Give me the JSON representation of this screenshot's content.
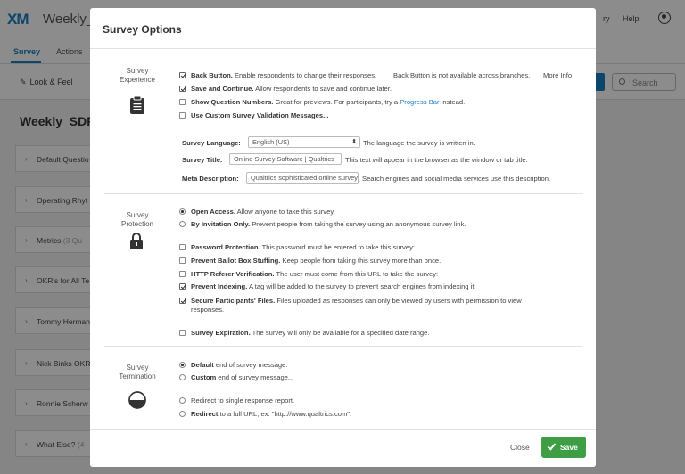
{
  "app": {
    "logo": "XM",
    "title": "Weekly_S",
    "nav_right": [
      "ry",
      "Help"
    ],
    "tabs": [
      "Survey",
      "Actions"
    ],
    "toolbar": {
      "look_feel": "Look & Feel",
      "search_placeholder": "Search"
    },
    "survey_heading": "Weekly_SDR",
    "blocks": [
      {
        "label": "Default Questio",
        "sub": ""
      },
      {
        "label": "Operating Rhyt",
        "sub": ""
      },
      {
        "label": "Metrics",
        "sub": "(3 Qu"
      },
      {
        "label": "OKR's for All Te",
        "sub": ""
      },
      {
        "label": "Tommy Herman",
        "sub": ""
      },
      {
        "label": "Nick Binks OKR",
        "sub": ""
      },
      {
        "label": "Ronnie Scherw",
        "sub": ""
      },
      {
        "label": "What Else?",
        "sub": "(4"
      }
    ]
  },
  "modal": {
    "title": "Survey Options",
    "sections": {
      "experience": {
        "label": [
          "Survey",
          "Experience"
        ],
        "options": [
          {
            "bold": "Back Button.",
            "text": " Enable respondents to change their responses."
          },
          {
            "bold": "Save and Continue.",
            "text": " Allow respondents to save and continue later."
          },
          {
            "bold": "Show Question Numbers.",
            "text": " Great for previews. For participants, try a ",
            "link": "Progress Bar",
            "after": " instead."
          },
          {
            "bold": "Use Custom Survey Validation Messages...",
            "text": ""
          }
        ],
        "back_button_note": "Back Button is not available across branches.",
        "more_info": "More Info",
        "language": {
          "label": "Survey Language:",
          "value": "English (US)",
          "help": "The language the survey is written in."
        },
        "survey_title": {
          "label": "Survey Title:",
          "value": "Online Survey Software | Qualtrics",
          "help": "This text will appear in the browser as the window or tab title."
        },
        "meta": {
          "label": "Meta Description:",
          "value": "Qualtrics sophisticated online survey",
          "help": "Search engines and social media services use this description."
        }
      },
      "protection": {
        "label": [
          "Survey",
          "Protection"
        ],
        "radios": [
          {
            "bold": "Open Access.",
            "text": " Allow anyone to take this survey."
          },
          {
            "bold": "By Invitation Only.",
            "text": " Prevent people from taking the survey using an anonymous survey link."
          }
        ],
        "checks": [
          {
            "bold": "Password Protection.",
            "text": " This password must be entered to take this survey:"
          },
          {
            "bold": "Prevent Ballot Box Stuffing.",
            "text": " Keep people from taking this survey more than once."
          },
          {
            "bold": "HTTP Referer Verification.",
            "text": " The user must come from this URL to take the survey:"
          },
          {
            "bold": "Prevent Indexing.",
            "text": " A tag will be added to the survey to prevent search engines from indexing it."
          },
          {
            "bold": "Secure Participants' Files.",
            "text": " Files uploaded as responses can only be viewed by users with permission to view responses."
          },
          {
            "bold": "Survey Expiration.",
            "text": " The survey will only be available for a specified date range."
          }
        ]
      },
      "termination": {
        "label": [
          "Survey",
          "Termination"
        ],
        "radios": [
          {
            "bold": "Default",
            "text": " end of survey message."
          },
          {
            "bold": "Custom",
            "text": " end of survey message..."
          },
          {
            "bold": "",
            "text": "Redirect to single response report."
          },
          {
            "bold": "Redirect",
            "text": " to a full URL, ex. \"http://www.qualtrics.com\":"
          }
        ]
      }
    },
    "footer": {
      "close": "Close",
      "save": "Save"
    }
  },
  "colors": {
    "accent": "#1a7fc2",
    "save_green": "#3e9e43",
    "overlay": "rgba(0,0,0,0.45)"
  }
}
